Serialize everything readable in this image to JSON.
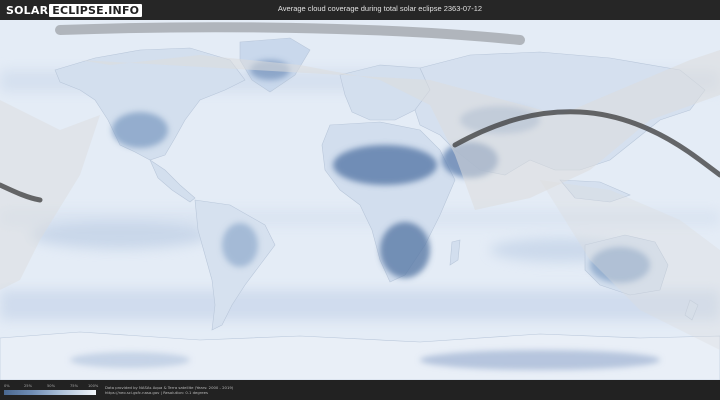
{
  "header": {
    "logo_part1": "SOLAR",
    "logo_part2": "ECLIPSE.INFO",
    "title": "Average cloud coverage during total solar eclipse 2363-07-12"
  },
  "map": {
    "ocean_color": "#e3ebf5",
    "land_color": "#d5e0ee",
    "cloud_dark_color": "#5b7aa6",
    "shadow_color": "#3a3a3a",
    "visibility_overlay_color": "#e8e8e8"
  },
  "legend": {
    "ticks": [
      "0%",
      "25%",
      "50%",
      "75%",
      "100%"
    ],
    "colors": [
      "#4a6890",
      "#6f8db5",
      "#a9bfd9",
      "#f3f7fb"
    ]
  },
  "credits": {
    "line1": "Data provided by NASAs Aqua & Terra satellite (Years: 2000 - 2019)",
    "line2": "https://neo.sci.gsfc.nasa.gov | Resolution: 0.1 degrees"
  }
}
